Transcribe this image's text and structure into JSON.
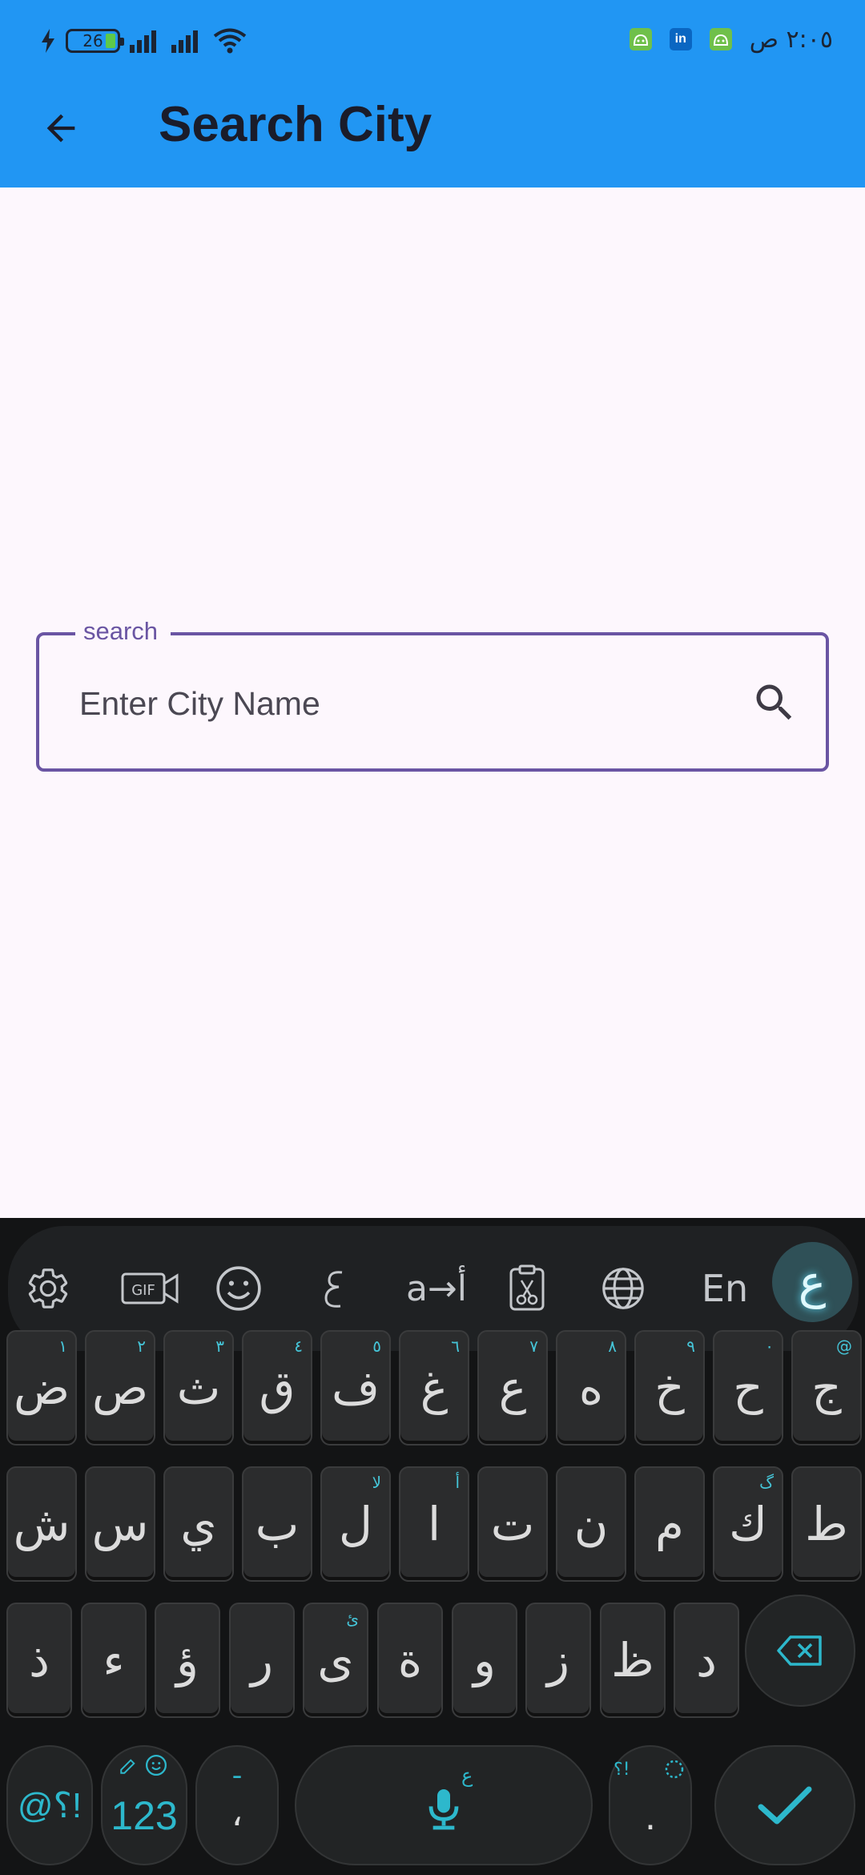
{
  "status_bar": {
    "time": "٢:٠٥ ص",
    "battery_level": "26",
    "icons": [
      "charging-bolt-icon",
      "battery-icon",
      "signal-icon",
      "signal-icon",
      "wifi-icon",
      "android-app-icon",
      "linkedin-icon",
      "android-app-icon"
    ],
    "linkedin_text": "in"
  },
  "app_bar": {
    "title": "Search City",
    "back_icon": "arrow-back-icon",
    "background": "#2196f3"
  },
  "search": {
    "label": "search",
    "placeholder": "Enter City Name",
    "value": "",
    "icon": "search-icon",
    "accent": "#6a55a3"
  },
  "keyboard": {
    "toolbar": {
      "gif_label": "GIF",
      "translate_label": "a→أ",
      "english_label": "En",
      "arabic_label": "ع",
      "icons": [
        "settings-icon",
        "gif-icon",
        "emoji-icon",
        "handwriting-icon",
        "translate-icon",
        "clipboard-icon",
        "globe-icon"
      ]
    },
    "row1": [
      {
        "char": "ض",
        "hint": "١"
      },
      {
        "char": "ص",
        "hint": "٢"
      },
      {
        "char": "ث",
        "hint": "٣"
      },
      {
        "char": "ق",
        "hint": "٤"
      },
      {
        "char": "ف",
        "hint": "٥"
      },
      {
        "char": "غ",
        "hint": "٦"
      },
      {
        "char": "ع",
        "hint": "٧"
      },
      {
        "char": "ه",
        "hint": "٨"
      },
      {
        "char": "خ",
        "hint": "٩"
      },
      {
        "char": "ح",
        "hint": "٠"
      },
      {
        "char": "ج",
        "hint": "@"
      }
    ],
    "row2": [
      {
        "char": "ش",
        "hint": ""
      },
      {
        "char": "س",
        "hint": ""
      },
      {
        "char": "ي",
        "hint": ""
      },
      {
        "char": "ب",
        "hint": ""
      },
      {
        "char": "ل",
        "hint": "لا"
      },
      {
        "char": "ا",
        "hint": "أ"
      },
      {
        "char": "ت",
        "hint": ""
      },
      {
        "char": "ن",
        "hint": ""
      },
      {
        "char": "م",
        "hint": ""
      },
      {
        "char": "ك",
        "hint": "گ"
      },
      {
        "char": "ط",
        "hint": ""
      }
    ],
    "row3": [
      {
        "char": "ذ",
        "hint": ""
      },
      {
        "char": "ء",
        "hint": ""
      },
      {
        "char": "ؤ",
        "hint": ""
      },
      {
        "char": "ر",
        "hint": ""
      },
      {
        "char": "ى",
        "hint": "ئ"
      },
      {
        "char": "ة",
        "hint": ""
      },
      {
        "char": "و",
        "hint": ""
      },
      {
        "char": "ز",
        "hint": ""
      },
      {
        "char": "ظ",
        "hint": ""
      },
      {
        "char": "د",
        "hint": ""
      }
    ],
    "bottom": {
      "symbols_label": "@؟!",
      "numbers_label": "123",
      "comma_label": "،",
      "comma_hint": "ـ",
      "space_hint": "ع",
      "period_label": ".",
      "period_hint": "؟!",
      "accent": "#2db8cc"
    }
  }
}
